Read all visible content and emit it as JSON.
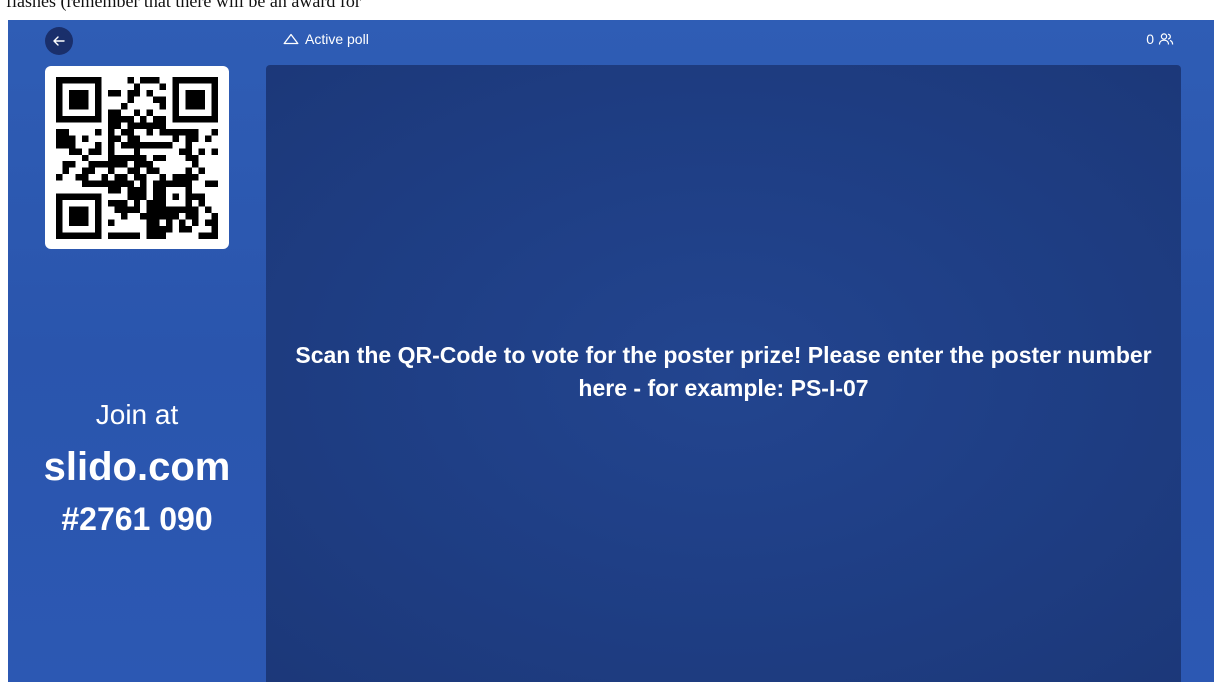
{
  "background_text": "flashes (remember that there will be an award for",
  "header": {
    "status_label": "Active poll",
    "participant_count": "0"
  },
  "join": {
    "label": "Join at",
    "domain": "slido.com",
    "code": "#2761 090"
  },
  "poll": {
    "question": "Scan the QR-Code to vote for the poster prize! Please enter the poster number here - for example: PS-I-07"
  },
  "icons": {
    "back": "arrow-left-icon",
    "status": "cloud-icon",
    "participants": "users-icon"
  },
  "colors": {
    "app_background": "#2c58b3",
    "panel_background": "#1f3f86",
    "back_button": "#1a2f6b",
    "text": "#ffffff"
  }
}
